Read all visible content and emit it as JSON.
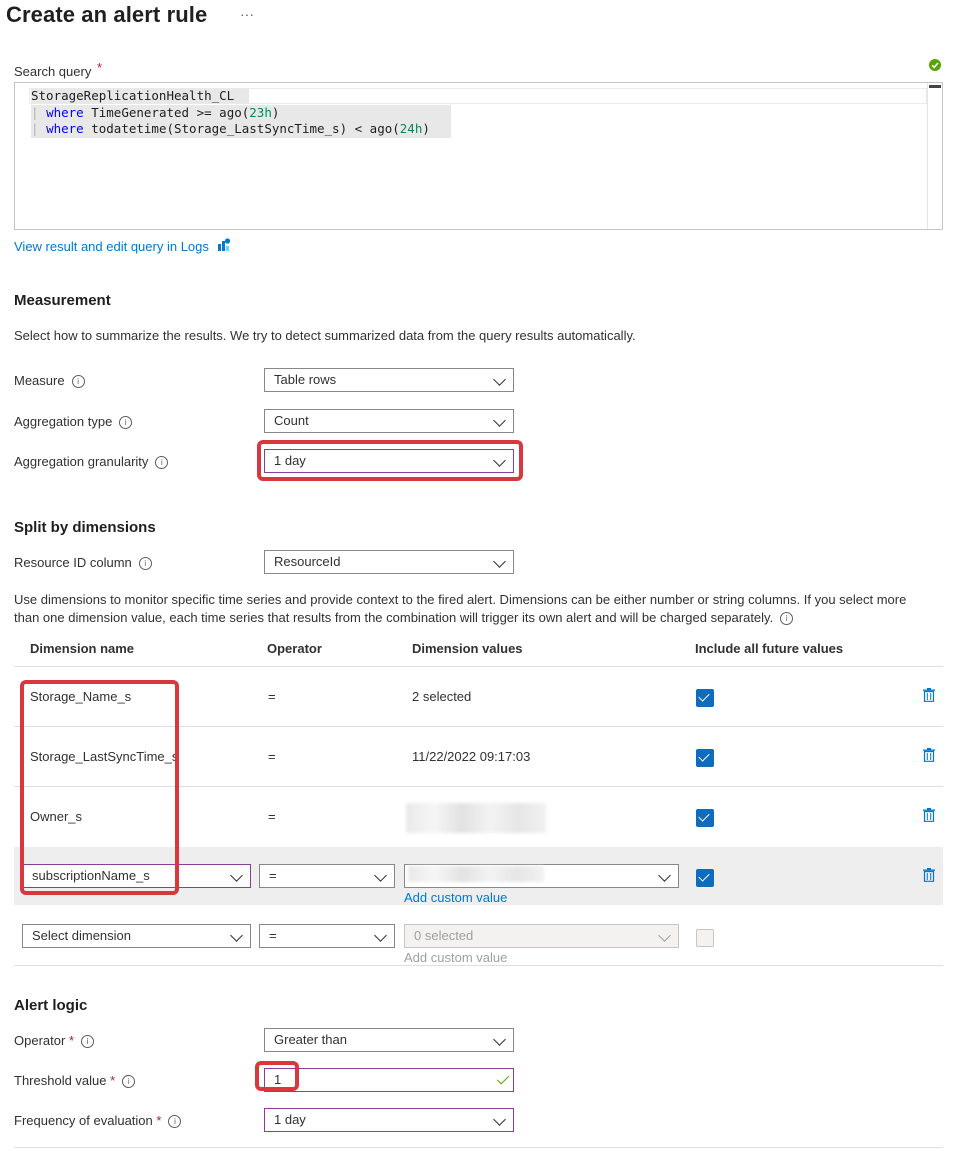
{
  "page": {
    "title": "Create an alert rule",
    "more_label": "···"
  },
  "query": {
    "label": "Search query",
    "required_mark": "*",
    "lines": [
      {
        "pipe": "",
        "keyword": "",
        "text": "StorageReplicationHealth_CL",
        "num": "",
        "tail": ""
      },
      {
        "pipe": "|",
        "keyword": "where",
        "text": " TimeGenerated >= ago(",
        "num": "23h",
        "tail": ")"
      },
      {
        "pipe": "|",
        "keyword": "where",
        "text": " todatetime(Storage_LastSyncTime_s) < ago(",
        "num": "24h",
        "tail": ")"
      }
    ],
    "view_link": "View result and edit query in Logs"
  },
  "measurement": {
    "heading": "Measurement",
    "description": "Select how to summarize the results. We try to detect summarized data from the query results automatically.",
    "measure_label": "Measure",
    "measure_value": "Table rows",
    "aggregation_type_label": "Aggregation type",
    "aggregation_type_value": "Count",
    "granularity_label": "Aggregation granularity",
    "granularity_value": "1 day"
  },
  "split": {
    "heading": "Split by dimensions",
    "resource_label": "Resource ID column",
    "resource_value": "ResourceId",
    "description_line1": "Use dimensions to monitor specific time series and provide context to the fired alert. Dimensions can be either number or string columns. If you select more",
    "description_line2": "than one dimension value, each time series that results from the combination will trigger its own alert and will be charged separately.",
    "headers": {
      "name": "Dimension name",
      "operator": "Operator",
      "values": "Dimension values",
      "future": "Include all future values"
    },
    "rows": [
      {
        "name": "Storage_Name_s",
        "operator": "=",
        "values": "2 selected",
        "checked": true
      },
      {
        "name": "Storage_LastSyncTime_s",
        "operator": "=",
        "values": "11/22/2022 09:17:03",
        "checked": true
      },
      {
        "name": "Owner_s",
        "operator": "=",
        "values": "",
        "checked": true
      }
    ],
    "edit_row": {
      "name": "subscriptionName_s",
      "operator": "=",
      "add_custom": "Add custom value",
      "checked": true
    },
    "new_row": {
      "name": "Select dimension",
      "operator": "=",
      "values": "0 selected",
      "add_custom": "Add custom value",
      "checked": false
    }
  },
  "alert_logic": {
    "heading": "Alert logic",
    "operator_label": "Operator",
    "operator_value": "Greater than",
    "threshold_label": "Threshold value",
    "threshold_value": "1",
    "frequency_label": "Frequency of evaluation",
    "frequency_value": "1 day",
    "required_mark": "*"
  },
  "colors": {
    "accent": "#0078d4",
    "checkbox": "#0f6cbd",
    "highlight": "#d9363e",
    "focus": "#8a3e9a",
    "valid": "#57a300"
  }
}
